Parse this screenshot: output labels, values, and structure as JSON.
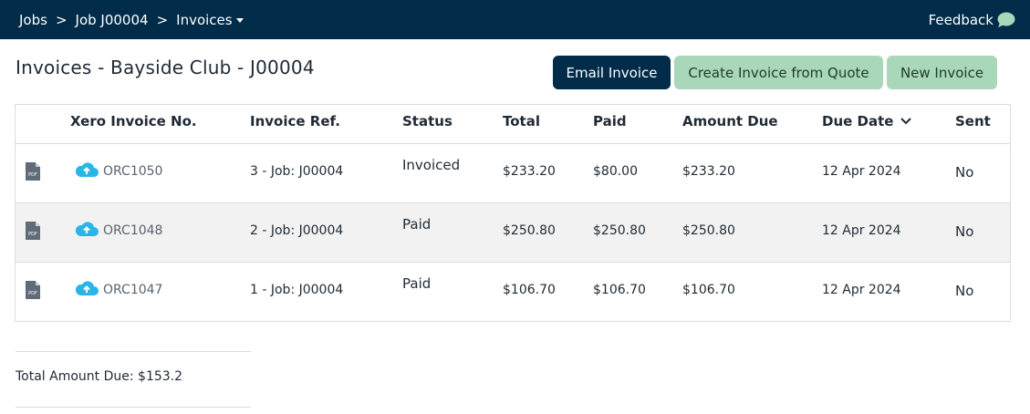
{
  "breadcrumb": {
    "items": [
      "Jobs",
      "Job J00004",
      "Invoices"
    ],
    "separator": ">"
  },
  "feedback": {
    "label": "Feedback",
    "icon": "speech-bubble-icon"
  },
  "page": {
    "title": "Invoices - Bayside Club - J00004"
  },
  "actions": {
    "email_invoice": "Email Invoice",
    "create_from_quote": "Create Invoice from Quote",
    "new_invoice": "New Invoice"
  },
  "table": {
    "headers": {
      "xero_no": "Xero Invoice No.",
      "ref": "Invoice Ref.",
      "status": "Status",
      "total": "Total",
      "paid": "Paid",
      "amount_due": "Amount Due",
      "due_date": "Due Date",
      "sent": "Sent"
    },
    "rows": [
      {
        "xero_no": "ORC1050",
        "ref": "3 - Job: J00004",
        "status": "Invoiced",
        "total": "$233.20",
        "paid": "$80.00",
        "amount_due": "$233.20",
        "due_date": "12 Apr 2024",
        "sent": "No"
      },
      {
        "xero_no": "ORC1048",
        "ref": "2 - Job: J00004",
        "status": "Paid",
        "total": "$250.80",
        "paid": "$250.80",
        "amount_due": "$250.80",
        "due_date": "12 Apr 2024",
        "sent": "No"
      },
      {
        "xero_no": "ORC1047",
        "ref": "1 - Job: J00004",
        "status": "Paid",
        "total": "$106.70",
        "paid": "$106.70",
        "amount_due": "$106.70",
        "due_date": "12 Apr 2024",
        "sent": "No"
      }
    ]
  },
  "summary": {
    "total_amount_due": "Total Amount Due: $153.2"
  },
  "colors": {
    "nav": "#002b49",
    "accent_green": "#a8d8b9",
    "cloud": "#29b6e6",
    "row_alt": "#f2f2f2"
  }
}
